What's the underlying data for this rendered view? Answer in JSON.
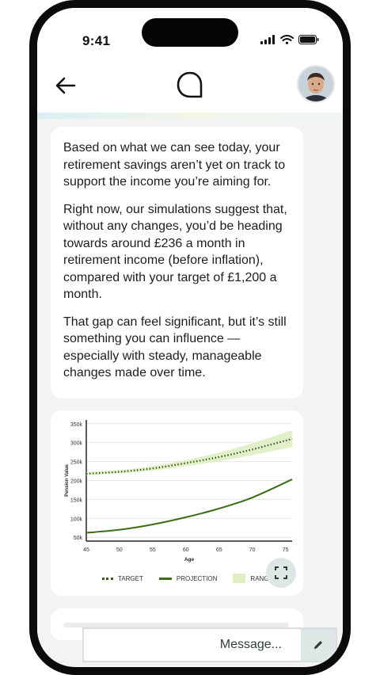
{
  "status_bar": {
    "time": "9:41"
  },
  "header": {
    "back_icon": "arrow-left-icon",
    "logo_icon": "chat-bubble-logo-icon",
    "avatar": "user-avatar"
  },
  "messages": [
    {
      "paragraphs": [
        "Based on what we can see today, your retirement savings aren’t yet on track to support the income you’re aiming for.",
        "Right now, our simulations suggest that, without any changes, you’d be heading towards around £236 a month in retirement income (before inflation), compared with your target of £1,200 a month.",
        "That gap can feel significant, but it’s still something you can influence — especially with steady, manageable changes made over time."
      ]
    }
  ],
  "chart_data": {
    "type": "line",
    "xlabel": "Age",
    "ylabel": "Pension Value",
    "xlim": [
      45,
      76
    ],
    "ylim": [
      40000,
      360000
    ],
    "x_ticks": [
      45,
      50,
      55,
      60,
      65,
      70,
      75
    ],
    "y_ticks": [
      50000,
      100000,
      150000,
      200000,
      250000,
      300000,
      350000
    ],
    "y_tick_labels": [
      "50k",
      "100k",
      "150k",
      "200k",
      "250k",
      "300k",
      "350k"
    ],
    "grid": true,
    "legend_position": "bottom",
    "series": [
      {
        "name": "TARGET",
        "style": "dotted",
        "color": "#3a5a1c",
        "x": [
          45,
          50,
          55,
          60,
          65,
          70,
          76
        ],
        "y": [
          218000,
          223000,
          232000,
          246000,
          262000,
          282000,
          310000
        ]
      },
      {
        "name": "PROJECTION",
        "style": "solid",
        "color": "#3d6b16",
        "x": [
          45,
          50,
          55,
          60,
          65,
          70,
          76
        ],
        "y": [
          62000,
          70000,
          84000,
          103000,
          126000,
          155000,
          203000
        ]
      }
    ],
    "range": {
      "name": "RANGE",
      "color": "#dfeec4",
      "x": [
        45,
        50,
        55,
        60,
        65,
        70,
        76
      ],
      "upper": [
        222000,
        228000,
        238000,
        254000,
        274000,
        298000,
        333000
      ],
      "lower": [
        214000,
        219000,
        226000,
        238000,
        251000,
        267000,
        288000
      ]
    }
  },
  "composer": {
    "placeholder": "Message..."
  },
  "colors": {
    "accent": "#3d6b16",
    "range": "#dfeec4",
    "background": "#f3f3f3"
  }
}
